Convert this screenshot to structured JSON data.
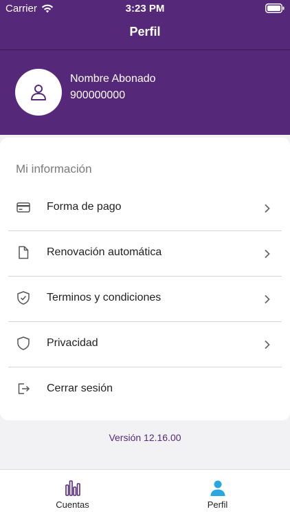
{
  "status_bar": {
    "carrier": "Carrier",
    "time": "3:23 PM"
  },
  "nav": {
    "title": "Perfil"
  },
  "profile": {
    "name": "Nombre Abonado",
    "phone": "900000000"
  },
  "section": {
    "title": "Mi información"
  },
  "menu": [
    {
      "label": "Forma de pago",
      "icon": "credit-card-icon",
      "has_chevron": true
    },
    {
      "label": "Renovación automática",
      "icon": "document-icon",
      "has_chevron": true
    },
    {
      "label": "Terminos y condiciones",
      "icon": "shield-check-icon",
      "has_chevron": true
    },
    {
      "label": "Privacidad",
      "icon": "shield-icon",
      "has_chevron": true
    },
    {
      "label": "Cerrar sesión",
      "icon": "logout-icon",
      "has_chevron": false
    }
  ],
  "version": "Versión 12.16.00",
  "tabs": [
    {
      "label": "Cuentas",
      "icon": "bar-chart-icon",
      "active": false
    },
    {
      "label": "Perfil",
      "icon": "person-icon",
      "active": true
    }
  ],
  "colors": {
    "brand": "#55287a",
    "active_tab": "#2aa7e0",
    "background": "#f2f2f4"
  }
}
